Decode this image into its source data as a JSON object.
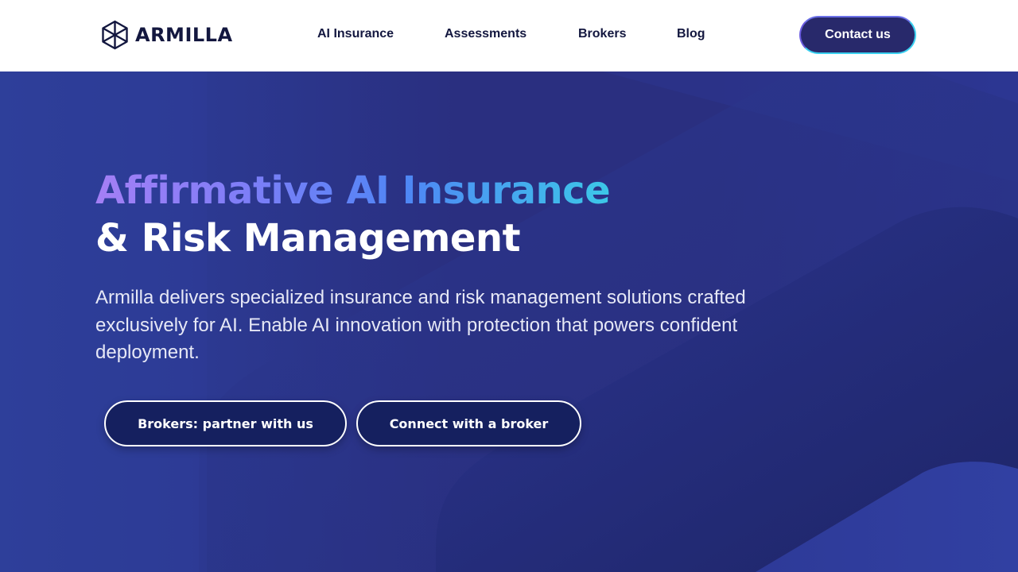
{
  "brand": {
    "name": "ARMILLA",
    "icon": "armilla-hexagon-logo"
  },
  "nav": {
    "items": [
      {
        "label": "AI Insurance"
      },
      {
        "label": "Assessments"
      },
      {
        "label": "Brokers"
      },
      {
        "label": "Blog"
      }
    ],
    "contact_label": "Contact us"
  },
  "hero": {
    "title_line1": "Affirmative AI Insurance",
    "title_line2": "& Risk Management",
    "description": "Armilla delivers specialized insurance and risk management solutions crafted exclusively for AI. Enable AI innovation with protection that powers confident deployment.",
    "cta_primary": "Brokers: partner with us",
    "cta_secondary": "Connect with a broker"
  },
  "colors": {
    "header_bg": "#ffffff",
    "hero_bg": "#2b3590",
    "nav_text": "#13173f",
    "button_bg": "#15205f",
    "contact_bg": "#28296b",
    "title_gradient_start": "#a47ff5",
    "title_gradient_end": "#3cc8e8"
  }
}
